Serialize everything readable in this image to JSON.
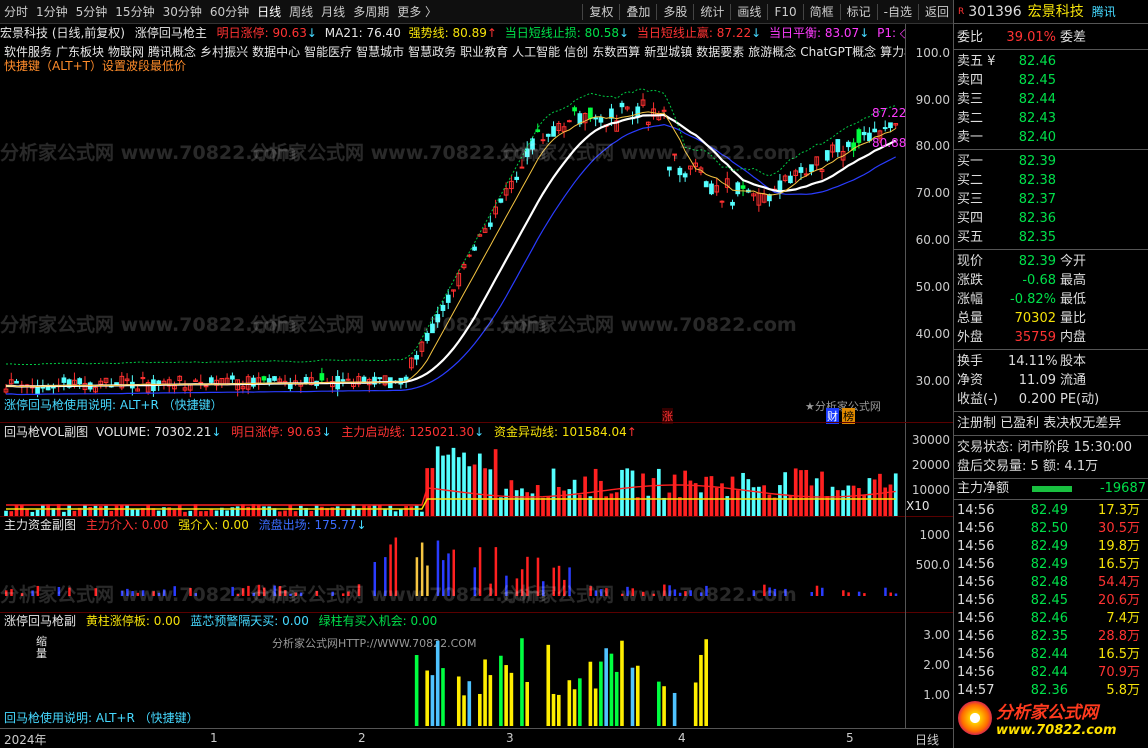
{
  "toolbar": {
    "periods": [
      "分时",
      "1分钟",
      "5分钟",
      "15分钟",
      "30分钟",
      "60分钟",
      "日线",
      "周线",
      "月线",
      "多周期",
      "更多 〉"
    ],
    "active_period": "日线",
    "actions": [
      "复权",
      "叠加",
      "多股",
      "统计",
      "画线",
      "F10",
      "简框",
      "标记",
      "-自选",
      "返回"
    ]
  },
  "main": {
    "stock_label": "宏景科技 (日线,前复权)",
    "indicator_name": "涨停回马枪主",
    "values": {
      "limit_up_tomorrow": "明日涨停: 90.63",
      "ma21": "MA21: 76.40",
      "strong_line": "强势线: 80.89",
      "short_stop": "当日短线止损: 80.58",
      "short_take": "当日短线止赢: 87.22",
      "balance": "当日平衡: 83.07",
      "p1": "P1: ◇"
    },
    "concepts": [
      "软件服务",
      "广东板块",
      "物联网",
      "腾讯概念",
      "乡村振兴",
      "数据中心",
      "智能医疗",
      "智慧城市",
      "智慧政务",
      "职业教育",
      "人工智能",
      "信创",
      "东数西算",
      "新型城镇",
      "数据要素",
      "旅游概念",
      "ChatGPT概念",
      "算力概"
    ],
    "shortcut": "快捷键（ALT+T）设置波段最低价",
    "usage_note": "涨停回马枪使用说明:  ALT+R （快捷键）",
    "y_labels": [
      "100.0",
      "90.00",
      "80.00",
      "70.00",
      "60.00",
      "50.00",
      "40.00",
      "30.00"
    ],
    "price_tags": [
      "87.22",
      "80.88"
    ],
    "watermark_site": "★分析家公式网",
    "badges": [
      "涨",
      "财",
      "榜"
    ]
  },
  "vol": {
    "name": "回马枪VOL副图",
    "volume": "VOLUME: 70302.21",
    "limit_up": "明日涨停: 90.63",
    "main_start": "主力启动线: 125021.30",
    "fund_abn": "资金异动线: 101584.04",
    "y_labels": [
      "30000",
      "20000",
      "10000"
    ],
    "x10": "X10"
  },
  "fund": {
    "name": "主力资金副图",
    "main_in": "主力介入: 0.00",
    "strong_in": "强介入: 0.00",
    "outflow": "流盘出场: 175.77",
    "y_labels": [
      "1000",
      "500.0"
    ]
  },
  "sub": {
    "name": "涨停回马枪副",
    "yellow": "黄柱涨停板: 0.00",
    "blue": "蓝芯预警隔天买: 0.00",
    "green": "绿柱有买入机会: 0.00",
    "left_tag": "缩量",
    "site": "分析家公式网HTTP://WWW.70822.COM",
    "usage": "回马枪使用说明:  ALT+R （快捷键）",
    "y_labels": [
      "3.00",
      "2.00",
      "1.00"
    ]
  },
  "xaxis": {
    "labels": [
      "2024年",
      "1",
      "2",
      "3",
      "4",
      "5"
    ],
    "right": "日线"
  },
  "watermark": "分析家公式网 www.70822.com",
  "side": {
    "code": "301396",
    "name": "宏景科技",
    "tag": "腾讯",
    "r": "R",
    "weibi": {
      "label": "委比",
      "value": "39.01%",
      "label2": "委差"
    },
    "asks": [
      {
        "label": "卖五 ¥",
        "price": "82.46"
      },
      {
        "label": "卖四",
        "price": "82.45"
      },
      {
        "label": "卖三",
        "price": "82.44"
      },
      {
        "label": "卖二",
        "price": "82.43"
      },
      {
        "label": "卖一",
        "price": "82.40"
      }
    ],
    "bids": [
      {
        "label": "买一",
        "price": "82.39"
      },
      {
        "label": "买二",
        "price": "82.38"
      },
      {
        "label": "买三",
        "price": "82.37"
      },
      {
        "label": "买四",
        "price": "82.36"
      },
      {
        "label": "买五",
        "price": "82.35"
      }
    ],
    "quote": [
      {
        "l": "现价",
        "v": "82.39",
        "c": "green",
        "r": "今开"
      },
      {
        "l": "涨跌",
        "v": "-0.68",
        "c": "green",
        "r": "最高"
      },
      {
        "l": "涨幅",
        "v": "-0.82%",
        "c": "green",
        "r": "最低"
      },
      {
        "l": "总量",
        "v": "70302",
        "c": "yellow",
        "r": "量比"
      },
      {
        "l": "外盘",
        "v": "35759",
        "c": "red",
        "r": "内盘"
      }
    ],
    "stats": [
      {
        "l": "换手",
        "v": "14.11%",
        "r": "股本"
      },
      {
        "l": "净资",
        "v": "11.09",
        "r": "流通"
      },
      {
        "l": "收益(-)",
        "v": "0.200",
        "r": "PE(动)"
      }
    ],
    "reg": "注册制 已盈利 表决权无差异",
    "status": "交易状态: 闭市阶段 15:30:00",
    "after": "盘后交易量: 5  额: 4.1万",
    "net": {
      "label": "主力净额",
      "value": "-19687"
    },
    "ticks": [
      {
        "t": "14:56",
        "p": "82.49",
        "v": "17.3万"
      },
      {
        "t": "14:56",
        "p": "82.50",
        "v": "30.5万"
      },
      {
        "t": "14:56",
        "p": "82.49",
        "v": "19.8万"
      },
      {
        "t": "14:56",
        "p": "82.49",
        "v": "16.5万"
      },
      {
        "t": "14:56",
        "p": "82.48",
        "v": "54.4万"
      },
      {
        "t": "14:56",
        "p": "82.45",
        "v": "20.6万"
      },
      {
        "t": "14:56",
        "p": "82.46",
        "v": "7.4万"
      },
      {
        "t": "14:56",
        "p": "82.35",
        "v": "28.8万"
      },
      {
        "t": "14:56",
        "p": "82.44",
        "v": "16.5万"
      },
      {
        "t": "14:56",
        "p": "82.44",
        "v": "70.9万"
      },
      {
        "t": "14:57",
        "p": "82.36",
        "v": "5.8万"
      }
    ],
    "logo_text": "分析家公式网",
    "logo_url": "www.70822.com"
  }
}
